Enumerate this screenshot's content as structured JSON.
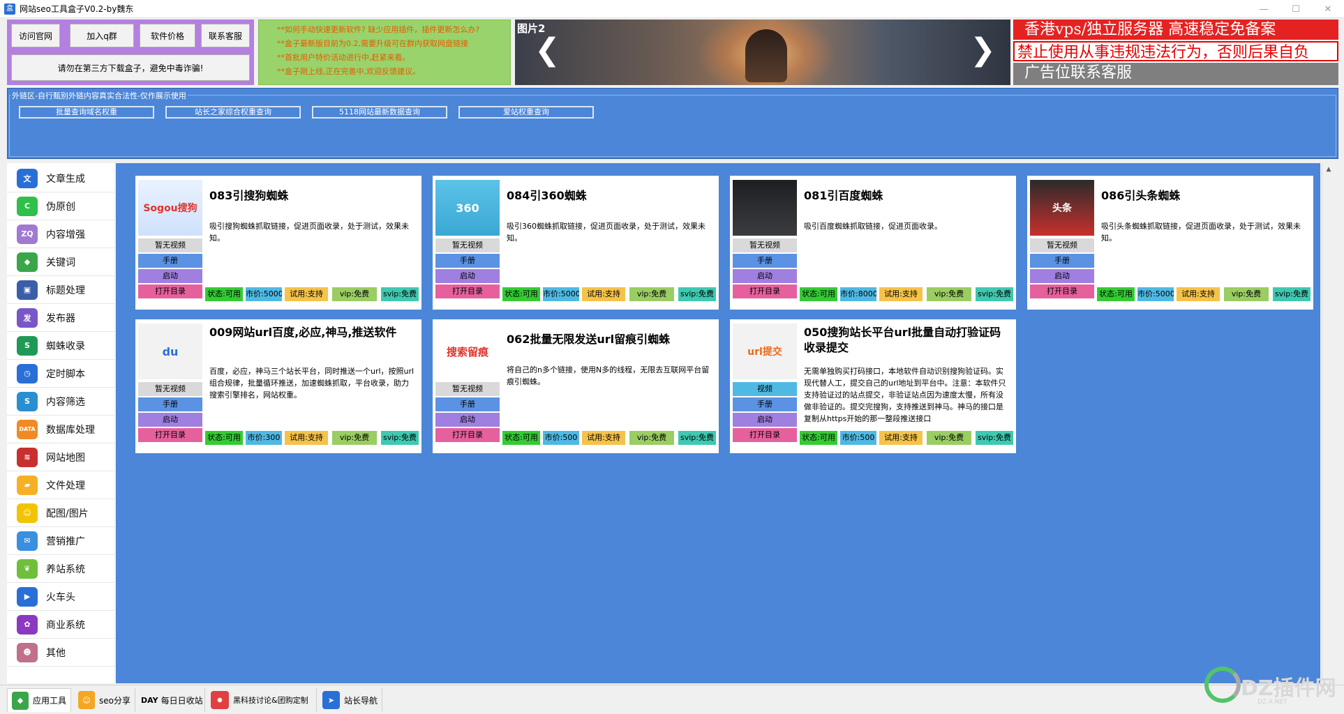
{
  "window": {
    "title": "网站seo工具盒子V0.2-by魏东",
    "app_icon": "盒",
    "controls": {
      "minimize": "—",
      "maximize": "☐",
      "close": "✕"
    }
  },
  "top_buttons": {
    "visit": "访问官网",
    "join_qq": "加入q群",
    "price": "软件价格",
    "support": "联系客服",
    "warning": "请勿在第三方下载盒子，避免中毒诈骗!"
  },
  "notice": [
    "**如何手动快速更新软件? 缺少应用插件，插件更新怎么办?",
    "**盒子最新版目前为0.2,需要升级可在群内获取网盘链接",
    "**首批用户特价活动进行中,赶紧来看。",
    "**盒子刚上线,正在完善中,欢迎反馈建议。"
  ],
  "banner": {
    "label": "图片2",
    "prev": "❮",
    "next": "❯"
  },
  "ad": {
    "line1": "香港vps/独立服务器   高速稳定免备案",
    "line2": "禁止使用从事违规违法行为，否则后果自负",
    "line3": "广告位联系客服"
  },
  "link_area": {
    "legend": "外链区-自行甄别外链内容真实合法性-仅作展示使用",
    "buttons": [
      "批量查询域名权重",
      "站长之家综合权重查询",
      "5118网站最新数据查询",
      "爱站权重查询"
    ]
  },
  "sidebar": [
    {
      "label": "文章生成",
      "icon": "book-icon",
      "color": "#2a6fd6",
      "glyph": "文"
    },
    {
      "label": "伪原创",
      "icon": "refresh-icon",
      "color": "#2fbf4a",
      "glyph": "C"
    },
    {
      "label": "内容增强",
      "icon": "zq-icon",
      "color": "#a07ad0",
      "glyph": "ZQ"
    },
    {
      "label": "关键词",
      "icon": "cube-icon",
      "color": "#3aa64a",
      "glyph": "◆"
    },
    {
      "label": "标题处理",
      "icon": "box-icon",
      "color": "#3a5ea8",
      "glyph": "▣"
    },
    {
      "label": "发布器",
      "icon": "publish-icon",
      "color": "#7a55c8",
      "glyph": "发"
    },
    {
      "label": "蜘蛛收录",
      "icon": "spider-icon",
      "color": "#1e9a56",
      "glyph": "S"
    },
    {
      "label": "定时脚本",
      "icon": "clock-icon",
      "color": "#2a6fd6",
      "glyph": "◷"
    },
    {
      "label": "内容筛选",
      "icon": "filter-icon",
      "color": "#2a8fd0",
      "glyph": "S"
    },
    {
      "label": "数据库处理",
      "icon": "database-icon",
      "color": "#f08a24",
      "glyph": "DATA"
    },
    {
      "label": "网站地图",
      "icon": "sitemap-icon",
      "color": "#c83030",
      "glyph": "≋"
    },
    {
      "label": "文件处理",
      "icon": "folder-icon",
      "color": "#f5b025",
      "glyph": "▰"
    },
    {
      "label": "配图/图片",
      "icon": "image-icon",
      "color": "#f2c400",
      "glyph": "☺"
    },
    {
      "label": "营销推广",
      "icon": "marketing-icon",
      "color": "#3a8fe0",
      "glyph": "✉"
    },
    {
      "label": "养站系统",
      "icon": "plant-icon",
      "color": "#6fbf3a",
      "glyph": "❦"
    },
    {
      "label": "火车头",
      "icon": "train-icon",
      "color": "#2a6fd6",
      "glyph": "▶"
    },
    {
      "label": "商业系统",
      "icon": "gear-icon",
      "color": "#8a3ac0",
      "glyph": "✿"
    },
    {
      "label": "其他",
      "icon": "avatar-icon",
      "color": "#c0708a",
      "glyph": "☻"
    }
  ],
  "cards": [
    {
      "title": "083引搜狗蜘蛛",
      "desc": "吸引搜狗蜘蛛抓取链接，促进页面收录，处于测试，效果未知。",
      "thumb_text": "Sogou搜狗",
      "thumb_icon": "sogou-logo",
      "video": "暂无视频",
      "manual": "手册",
      "start": "启动",
      "open": "打开目录",
      "status": "状态:可用",
      "price": "市价:5000",
      "trial": "试用:支持",
      "vip": "vip:免费",
      "svip": "svip:免费"
    },
    {
      "title": "084引360蜘蛛",
      "desc": "吸引360蜘蛛抓取链接，促进页面收录，处于测试，效果未知。",
      "thumb_text": "360",
      "thumb_icon": "360-spider-logo",
      "video": "暂无视频",
      "manual": "手册",
      "start": "启动",
      "open": "打开目录",
      "status": "状态:可用",
      "price": "市价:5000",
      "trial": "试用:支持",
      "vip": "vip:免费",
      "svip": "svip:免费"
    },
    {
      "title": "081引百度蜘蛛",
      "desc": "吸引百度蜘蛛抓取链接，促进页面收录。",
      "thumb_text": "",
      "thumb_icon": "dark-room-image",
      "video": "暂无视频",
      "manual": "手册",
      "start": "启动",
      "open": "打开目录",
      "status": "状态:可用",
      "price": "市价:8000",
      "trial": "试用:支持",
      "vip": "vip:免费",
      "svip": "svip:免费"
    },
    {
      "title": "086引头条蜘蛛",
      "desc": "吸引头条蜘蛛抓取链接，促进页面收录，处于测试，效果未知。",
      "thumb_text": "头条",
      "thumb_icon": "toutiao-spiderman-image",
      "video": "暂无视频",
      "manual": "手册",
      "start": "启动",
      "open": "打开目录",
      "status": "状态:可用",
      "price": "市价:5000",
      "trial": "试用:支持",
      "vip": "vip:免费",
      "svip": "svip:免费"
    },
    {
      "title": "009网站url百度,必应,神马,推送软件",
      "desc": "百度，必应，神马三个站长平台，同时推送一个url，按照url组合规律，批量循环推送，加速蜘蛛抓取，平台收录，助力搜索引擎排名，网站权重。",
      "thumb_text": "du",
      "thumb_icon": "baidu-bing-shenma-logos",
      "video": "暂无视频",
      "manual": "手册",
      "start": "启动",
      "open": "打开目录",
      "status": "状态:可用",
      "price": "市价:300",
      "trial": "试用:支持",
      "vip": "vip:免费",
      "svip": "svip:免费"
    },
    {
      "title": "062批量无限发送url留痕引蜘蛛",
      "desc": "将自己的n多个链接，使用N多的线程，无限去互联网平台留痕引蜘蛛。",
      "thumb_text": "搜索留痕",
      "thumb_icon": "baidu-search-trace-logo",
      "video": "暂无视频",
      "manual": "手册",
      "start": "启动",
      "open": "打开目录",
      "status": "状态:可用",
      "price": "市价:500",
      "trial": "试用:支持",
      "vip": "vip:免费",
      "svip": "svip:免费"
    },
    {
      "title": "050搜狗站长平台url批量自动打验证码收录提交",
      "desc": "无需单独购买打码接口，本地软件自动识别搜狗验证码。实现代替人工，提交自己的url地址到平台中。注意：本软件只支持验证过的站点提交，非验证站点因为速度太慢，所有没做非验证的。提交完搜狗，支持推送到神马。神马的接口是复制从https开始的那一整段推送接口",
      "thumb_text": "url提交",
      "thumb_icon": "sogou-url-submit-logo",
      "video": "视频",
      "manual": "手册",
      "start": "启动",
      "open": "打开目录",
      "status": "状态:可用",
      "price": "市价:500",
      "trial": "试用:支持",
      "vip": "vip:免费",
      "svip": "svip:免费"
    }
  ],
  "bottom_tabs": [
    {
      "label": "应用工具",
      "icon": "cube-icon",
      "glyph": "◆",
      "color": "#3aa64a"
    },
    {
      "label": "seo分享",
      "icon": "share-icon",
      "glyph": "☺",
      "color": "#f5a623"
    },
    {
      "label": "每日日收站",
      "icon": "day-icon",
      "glyph": "DAY",
      "color": "#f0f0f0"
    },
    {
      "label": "黑科技讨论&团购定制",
      "icon": "gear-red-icon",
      "glyph": "✹",
      "color": "#e04040"
    },
    {
      "label": "站长导航",
      "icon": "navigation-icon",
      "glyph": "➤",
      "color": "#2a6fd6"
    }
  ],
  "watermark": {
    "text": "DZ插件网",
    "sub": "DZ-X.NET"
  }
}
